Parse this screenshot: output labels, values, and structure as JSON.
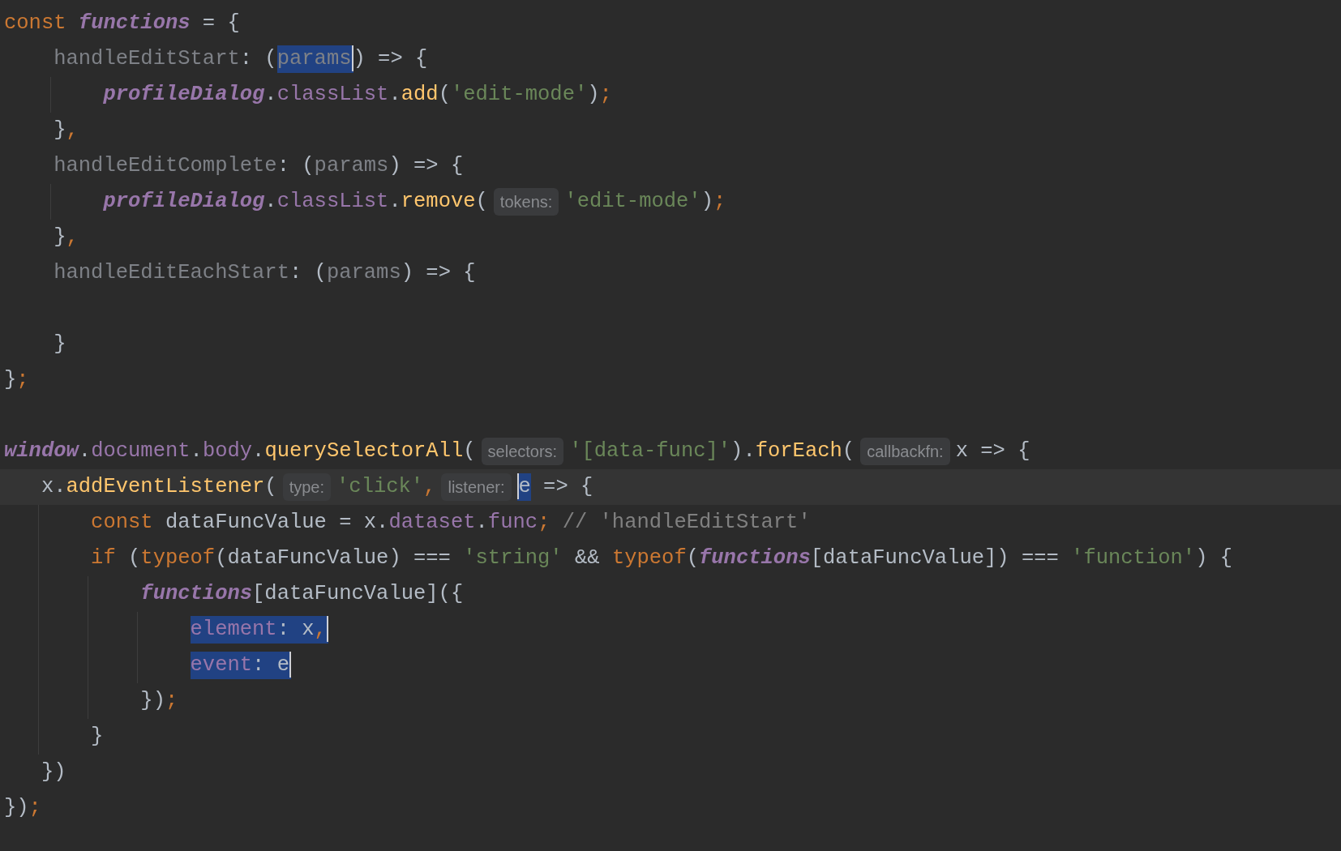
{
  "editor": {
    "lines": [
      {
        "tokens": [
          {
            "text": "const ",
            "kind": "keyword"
          },
          {
            "text": "functions",
            "kind": "italic"
          },
          {
            "text": " = {",
            "kind": "plain"
          }
        ]
      },
      {
        "tokens": [
          {
            "text": "    handleEditStart",
            "kind": "gray"
          },
          {
            "text": ": (",
            "kind": "plain"
          },
          {
            "text": "params",
            "kind": "gray",
            "selected": true,
            "caret_after": true
          },
          {
            "text": ") => {",
            "kind": "plain"
          }
        ]
      },
      {
        "tokens": [
          {
            "text": "        profileDialog",
            "kind": "italic"
          },
          {
            "text": ".",
            "kind": "plain"
          },
          {
            "text": "classList",
            "kind": "prop"
          },
          {
            "text": ".",
            "kind": "plain"
          },
          {
            "text": "add",
            "kind": "method"
          },
          {
            "text": "(",
            "kind": "plain"
          },
          {
            "text": "'edit-mode'",
            "kind": "string"
          },
          {
            "text": ")",
            "kind": "plain"
          },
          {
            "text": ";",
            "kind": "punct"
          }
        ]
      },
      {
        "tokens": [
          {
            "text": "    }",
            "kind": "plain"
          },
          {
            "text": ",",
            "kind": "punct"
          }
        ]
      },
      {
        "tokens": [
          {
            "text": "    handleEditComplete",
            "kind": "gray"
          },
          {
            "text": ": (",
            "kind": "plain"
          },
          {
            "text": "params",
            "kind": "gray"
          },
          {
            "text": ") => {",
            "kind": "plain"
          }
        ]
      },
      {
        "tokens": [
          {
            "text": "        profileDialog",
            "kind": "italic"
          },
          {
            "text": ".",
            "kind": "plain"
          },
          {
            "text": "classList",
            "kind": "prop"
          },
          {
            "text": ".",
            "kind": "plain"
          },
          {
            "text": "remove",
            "kind": "method"
          },
          {
            "text": "(",
            "kind": "plain"
          },
          {
            "text": "tokens:",
            "kind": "hint"
          },
          {
            "text": "'edit-mode'",
            "kind": "string"
          },
          {
            "text": ")",
            "kind": "plain"
          },
          {
            "text": ";",
            "kind": "punct"
          }
        ]
      },
      {
        "tokens": [
          {
            "text": "    }",
            "kind": "plain"
          },
          {
            "text": ",",
            "kind": "punct"
          }
        ]
      },
      {
        "tokens": [
          {
            "text": "    handleEditEachStart",
            "kind": "gray"
          },
          {
            "text": ": (",
            "kind": "plain"
          },
          {
            "text": "params",
            "kind": "gray"
          },
          {
            "text": ") => {",
            "kind": "plain"
          }
        ]
      },
      {
        "kind": "blank"
      },
      {
        "tokens": [
          {
            "text": "    }",
            "kind": "plain"
          }
        ]
      },
      {
        "tokens": [
          {
            "text": "}",
            "kind": "plain"
          },
          {
            "text": ";",
            "kind": "punct"
          }
        ]
      },
      {
        "kind": "blank"
      },
      {
        "tokens": [
          {
            "text": "window",
            "kind": "italic"
          },
          {
            "text": ".",
            "kind": "plain"
          },
          {
            "text": "document",
            "kind": "prop"
          },
          {
            "text": ".",
            "kind": "plain"
          },
          {
            "text": "body",
            "kind": "prop"
          },
          {
            "text": ".",
            "kind": "plain"
          },
          {
            "text": "querySelectorAll",
            "kind": "method"
          },
          {
            "text": "(",
            "kind": "plain"
          },
          {
            "text": "selectors:",
            "kind": "hint"
          },
          {
            "text": "'[data-func]'",
            "kind": "string"
          },
          {
            "text": ").",
            "kind": "plain"
          },
          {
            "text": "forEach",
            "kind": "method"
          },
          {
            "text": "(",
            "kind": "plain"
          },
          {
            "text": "callbackfn:",
            "kind": "hint"
          },
          {
            "text": "x => {",
            "kind": "plain"
          }
        ]
      },
      {
        "current": true,
        "tokens": [
          {
            "text": "   x.",
            "kind": "plain"
          },
          {
            "text": "addEventListener",
            "kind": "method"
          },
          {
            "text": "(",
            "kind": "plain"
          },
          {
            "text": "type:",
            "kind": "hint"
          },
          {
            "text": "'click'",
            "kind": "string"
          },
          {
            "text": ",",
            "kind": "punct"
          },
          {
            "text": "listener:",
            "kind": "hint"
          },
          {
            "text": "e",
            "kind": "plain",
            "selected": true,
            "caret_before": true
          },
          {
            "text": " => {",
            "kind": "plain"
          }
        ]
      },
      {
        "tokens": [
          {
            "text": "       const ",
            "kind": "keyword"
          },
          {
            "text": "dataFuncValue = x.",
            "kind": "plain"
          },
          {
            "text": "dataset",
            "kind": "prop"
          },
          {
            "text": ".",
            "kind": "plain"
          },
          {
            "text": "func",
            "kind": "prop"
          },
          {
            "text": ";",
            "kind": "punct"
          },
          {
            "text": " // 'handleEditStart'",
            "kind": "comment"
          }
        ]
      },
      {
        "tokens": [
          {
            "text": "       if ",
            "kind": "keyword"
          },
          {
            "text": "(",
            "kind": "plain"
          },
          {
            "text": "typeof",
            "kind": "keyword"
          },
          {
            "text": "(dataFuncValue) === ",
            "kind": "plain"
          },
          {
            "text": "'string'",
            "kind": "string"
          },
          {
            "text": " && ",
            "kind": "plain"
          },
          {
            "text": "typeof",
            "kind": "keyword"
          },
          {
            "text": "(",
            "kind": "plain"
          },
          {
            "text": "functions",
            "kind": "italic"
          },
          {
            "text": "[dataFuncValue]) === ",
            "kind": "plain"
          },
          {
            "text": "'function'",
            "kind": "string"
          },
          {
            "text": ") {",
            "kind": "plain"
          }
        ]
      },
      {
        "tokens": [
          {
            "text": "           functions",
            "kind": "italic"
          },
          {
            "text": "[dataFuncValue]({",
            "kind": "plain"
          }
        ]
      },
      {
        "tokens": [
          {
            "text": "               element",
            "kind": "prop",
            "selected": true
          },
          {
            "text": ": x",
            "kind": "plain",
            "selected": true
          },
          {
            "text": ",",
            "kind": "punct",
            "selected": true,
            "caret_after": true
          }
        ]
      },
      {
        "tokens": [
          {
            "text": "               event",
            "kind": "prop",
            "selected": true
          },
          {
            "text": ": e",
            "kind": "plain",
            "selected": true,
            "caret_after": true
          }
        ]
      },
      {
        "tokens": [
          {
            "text": "           })",
            "kind": "plain"
          },
          {
            "text": ";",
            "kind": "punct"
          }
        ]
      },
      {
        "tokens": [
          {
            "text": "       }",
            "kind": "plain"
          }
        ]
      },
      {
        "tokens": [
          {
            "text": "   })",
            "kind": "plain"
          }
        ]
      },
      {
        "tokens": [
          {
            "text": "})",
            "kind": "plain"
          },
          {
            "text": ";",
            "kind": "punct"
          }
        ]
      }
    ]
  }
}
